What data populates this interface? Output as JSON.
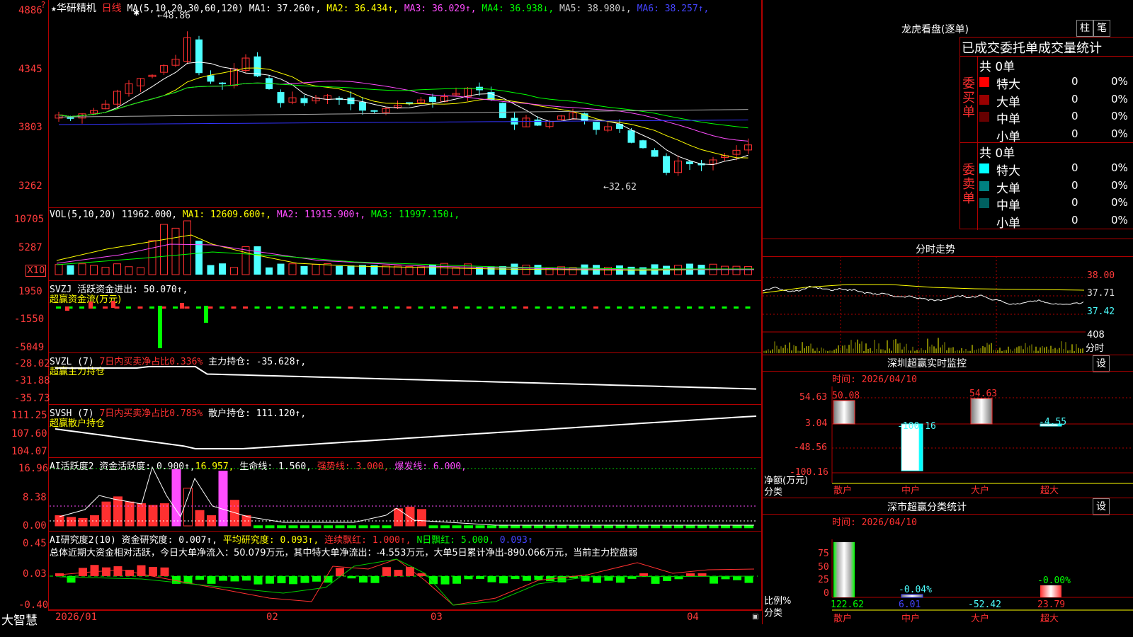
{
  "stock": {
    "name": "华研精机",
    "period": "日线",
    "ma_params": "MA(5,10,20,30,60,120)",
    "ma_values": [
      {
        "label": "MA1",
        "value": "37.260",
        "arrow": "↑",
        "color": "#ffffff"
      },
      {
        "label": "MA2",
        "value": "36.434",
        "arrow": "↑",
        "color": "#ffff00"
      },
      {
        "label": "MA3",
        "value": "36.029",
        "arrow": "↑",
        "color": "#ff4dff"
      },
      {
        "label": "MA4",
        "value": "36.938",
        "arrow": "↓",
        "color": "#00ff00"
      },
      {
        "label": "MA5",
        "value": "38.980",
        "arrow": "↓",
        "color": "#cccccc"
      },
      {
        "label": "MA6",
        "value": "38.257",
        "arrow": "↑",
        "color": "#4444ff"
      }
    ],
    "high_label": "48.86",
    "low_label": "32.62",
    "price_axis": [
      "4886",
      "4345",
      "3803",
      "3262"
    ]
  },
  "volume": {
    "header": "VOL(5,10,20)",
    "value": "11962.000",
    "ma": [
      {
        "label": "MA1",
        "value": "12609.600",
        "arrow": "↑",
        "color": "#ffff00"
      },
      {
        "label": "MA2",
        "value": "11915.900",
        "arrow": "↑",
        "color": "#ff4dff"
      },
      {
        "label": "MA3",
        "value": "11997.150",
        "arrow": "↓",
        "color": "#00ff00"
      }
    ],
    "axis": [
      "10705",
      "5287"
    ],
    "unit": "X10"
  },
  "svzj": {
    "header": "SVZJ  活跃资金进出: 50.070↑,",
    "sub": "超赢资金流(万元)",
    "axis": [
      "1950",
      "-1550",
      "-5049"
    ]
  },
  "svzl": {
    "header_a": "SVZL (7) ",
    "header_b": "7日内买卖净占比0.336%",
    "header_c": " 主力持仓: -35.628↑,",
    "sub": "超赢主力持仓",
    "axis": [
      "-28.02",
      "-31.88",
      "-35.73"
    ]
  },
  "svsh": {
    "header_a": "SVSH (7) ",
    "header_b": "7日内买卖净占比0.785%",
    "header_c": " 散户持仓: 111.120↑,",
    "sub": "超赢散户持仓",
    "axis": [
      "111.25",
      "107.60",
      "104.07"
    ]
  },
  "ai1": {
    "header_a": "AI活跃度2 资金活跃度: 0.900↑,",
    "header_b": "16.957,",
    "header_c": " 生命线: 1.560,",
    "header_d": " 强势线: 3.000,",
    "header_e": " 爆发线: 6.000,",
    "axis": [
      "16.96",
      "8.38",
      "0.00"
    ]
  },
  "ai2": {
    "header_a": "AI研究度2(10) 资金研究度: 0.007↑,",
    "header_b": " 平均研究度: 0.093↑,",
    "header_c": " 连续飘红: 1.000↑,",
    "header_d": " N日飘红: 5.000,",
    "header_e": " 0.093↑",
    "summary": "总体近期大资金相对活跃，今日大单净流入：50.079万元，其中特大单净流出：-4.553万元，大单5日累计净出-890.066万元，当前主力控盘弱",
    "axis": [
      "0.45",
      "0.03",
      "-0.40"
    ]
  },
  "date_axis": [
    "2026/01",
    "02",
    "03",
    "04"
  ],
  "brand": "大智慧",
  "dragon": {
    "title": "龙虎看盘(逐单)",
    "btn_bar": "柱",
    "btn_tick": "笔",
    "subtitle": "已成交委托单成交量统计",
    "buy_label": [
      "委",
      "买",
      "单"
    ],
    "sell_label": [
      "委",
      "卖",
      "单"
    ],
    "buy_total": "共 0单",
    "sell_total": "共 0单",
    "buy_rows": [
      {
        "name": "特大",
        "value": "0",
        "pct": "0%",
        "color": "#ff0000"
      },
      {
        "name": "大单",
        "value": "0",
        "pct": "0%",
        "color": "#990000"
      },
      {
        "name": "中单",
        "value": "0",
        "pct": "0%",
        "color": "#660000"
      },
      {
        "name": "小单",
        "value": "0",
        "pct": "0%",
        "color": ""
      }
    ],
    "sell_rows": [
      {
        "name": "特大",
        "value": "0",
        "pct": "0%",
        "color": "#00ffff"
      },
      {
        "name": "大单",
        "value": "0",
        "pct": "0%",
        "color": "#008080"
      },
      {
        "name": "中单",
        "value": "0",
        "pct": "0%",
        "color": "#006060"
      },
      {
        "name": "小单",
        "value": "0",
        "pct": "0%",
        "color": ""
      }
    ]
  },
  "intraday": {
    "title": "分时走势",
    "axis": [
      "38.00",
      "37.71",
      "37.42"
    ],
    "vol_label": "408",
    "vol_unit": "分时"
  },
  "monitor": {
    "title": "深圳超赢实时监控",
    "settings": "设",
    "time": "时间: 2026/04/10",
    "axis": [
      "54.63",
      "3.04",
      "-48.56",
      "-100.16"
    ],
    "unit_label": "净额(万元)",
    "cat_label": "分类",
    "bars": [
      {
        "name": "散户",
        "value": "50.08"
      },
      {
        "name": "中户",
        "value": "-100.16"
      },
      {
        "name": "大户",
        "value": "54.63"
      },
      {
        "name": "超大",
        "value": "-4.55"
      }
    ]
  },
  "classify": {
    "title": "深市超赢分类统计",
    "settings": "设",
    "time": "时间: 2026/04/10",
    "axis": [
      "75",
      "50",
      "25",
      "0"
    ],
    "unit_label": "比例%",
    "cat_label": "分类",
    "pct_labels": [
      "",
      "-0.04%",
      "",
      "-0.00%"
    ],
    "bars": [
      {
        "name": "散户",
        "value": "122.62"
      },
      {
        "name": "中户",
        "value": "6.01"
      },
      {
        "name": "大户",
        "value": "-52.42"
      },
      {
        "name": "超大",
        "value": "23.79"
      }
    ]
  }
}
